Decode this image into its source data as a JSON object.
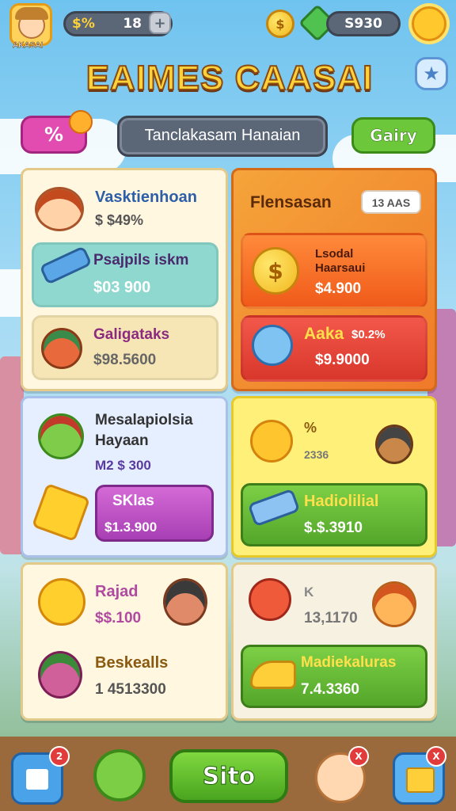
{
  "player": {
    "avatar_label": "AKASAI",
    "currency_prefix": "$%",
    "currency_value": "18",
    "add_symbol": "+"
  },
  "gems": {
    "value": "S930"
  },
  "title": "EAIMES CAASAI",
  "header": {
    "promo_symbol": "%",
    "search_value": "Tanclakasam Hanaian",
    "gallery_label": "Gairy",
    "star_symbol": "★"
  },
  "cards": {
    "c1": {
      "name": "Vasktienhoan",
      "price": "$ $49%"
    },
    "c2": {
      "name": "Psajpils iskm",
      "price": "$03 900"
    },
    "c3": {
      "name": "Galigataks",
      "price": "$98.5600"
    },
    "orange_panel": {
      "title": "Flensasan",
      "badge": "13 AAS"
    },
    "c4": {
      "name": "Lsodal\nHaarsaui",
      "price": "$4.900"
    },
    "c5": {
      "name": "Aaka",
      "price": "$0.2%",
      "price2": "$9.9000"
    },
    "c6": {
      "name": "Mesalapiolsia\nHayaan",
      "price": "M2 $ 300"
    },
    "c7": {
      "name": "SKlas",
      "price": "$1.3.900"
    },
    "c8": {
      "tag": "%",
      "price": "2336"
    },
    "c9": {
      "name": "Hadiolilial",
      "price": "$.$.3910"
    },
    "c10": {
      "name": "Rajad",
      "price": "$$.100"
    },
    "c11": {
      "name": "Beskealls",
      "price": "1 4513300"
    },
    "c12": {
      "tag": "K",
      "price": "13,1170"
    },
    "c13": {
      "name": "Madiekaluras",
      "price": "7.4.3360"
    }
  },
  "nav": {
    "play_label": "Sito",
    "badge1": "2",
    "badge2": "X",
    "badge3": "X"
  },
  "colors": {
    "accent_green": "#5bbb2c",
    "accent_orange": "#f07a2a",
    "accent_pink": "#e24bb0"
  }
}
